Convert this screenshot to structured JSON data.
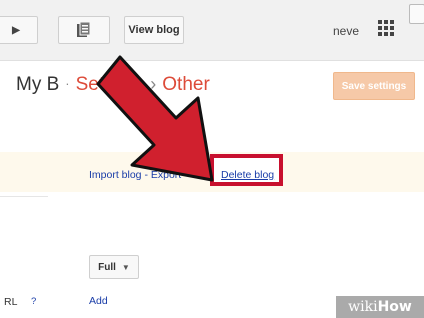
{
  "toolbar": {
    "back_icon": "chevron-right-icon",
    "pages_icon": "pages-icon",
    "view_blog_label": "View blog",
    "user_name": "neve",
    "apps_icon": "grid-icon"
  },
  "breadcrumb": {
    "root": "My B",
    "middle": "Settings",
    "current": "Other",
    "separator": "·",
    "separator_2": "›"
  },
  "save_settings_label": "Save settings",
  "blog_tools": {
    "import_export_text": "Import blog - Export",
    "delete_label": "Delete blog"
  },
  "feed": {
    "select_value": "Full",
    "url_label": "RL",
    "help_label": "?",
    "add_label": "Add"
  },
  "watermark": {
    "part1": "wiki",
    "part2": "How"
  },
  "colors": {
    "accent_red": "#dd4b39",
    "arrow_red": "#d0202e",
    "highlight_box": "#c8102e"
  }
}
